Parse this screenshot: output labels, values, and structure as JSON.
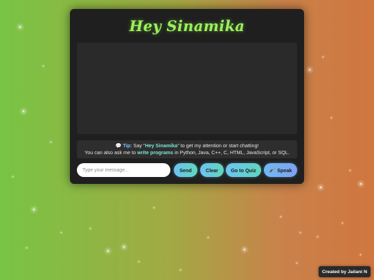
{
  "app": {
    "title": "Hey Sinamika"
  },
  "tip": {
    "icon": "speech-bubble-icon",
    "label": "Tip:",
    "line1_a": " Say \"",
    "line1_hl": "Hey Sinamika",
    "line1_b": "\" to get my attention or start chatting!",
    "line2_a": "You can also ask me to ",
    "line2_hl": "write programs",
    "line2_b": " in Python, Java, C++, C, HTML, JavaScript, or SQL."
  },
  "input": {
    "placeholder": "Type your message..."
  },
  "buttons": {
    "send": "Send",
    "clear": "Clear",
    "quiz": "Go to Quiz",
    "speak_icon": "microphone-icon",
    "speak": "Speak"
  },
  "footer": {
    "credit": "Created by Jailani N"
  },
  "colors": {
    "title": "#9cf05a",
    "card": "#1f1f1f",
    "button_gradient_start": "#6cc3f2",
    "button_gradient_end": "#5fd6bb",
    "background_start": "#78c444",
    "background_end": "#d0763f"
  }
}
